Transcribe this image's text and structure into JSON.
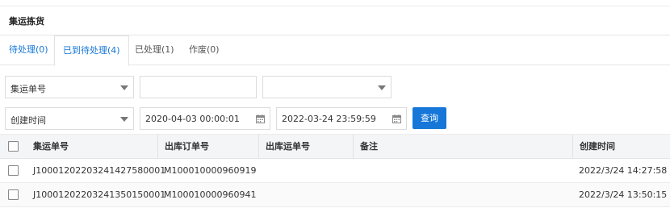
{
  "page": {
    "title": "集运拣货"
  },
  "tabs": [
    {
      "label": "待处理(0)"
    },
    {
      "label": "已到待处理(4)"
    },
    {
      "label": "已处理(1)"
    },
    {
      "label": "作废(0)"
    }
  ],
  "filters": {
    "search_field_select": "集运单号",
    "search_text": "",
    "extra_select": "",
    "date_field_select": "创建时间",
    "date_start": "2020-04-03 00:00:01",
    "date_end": "2022-03-24 23:59:59",
    "query_button": "查询"
  },
  "table": {
    "columns": [
      "集运单号",
      "出库订单号",
      "出库运单号",
      "备注",
      "创建时间"
    ],
    "rows": [
      {
        "consolidation_no": "J10001202203241427580001",
        "order_no": "M100010000960919",
        "waybill_no": "",
        "remark": "",
        "created": "2022/3/24 14:27:58"
      },
      {
        "consolidation_no": "J10001202203241350150001",
        "order_no": "M100010000960941",
        "waybill_no": "",
        "remark": "",
        "created": "2022/3/24 13:50:15"
      }
    ]
  },
  "colors": {
    "accent": "#1677d9",
    "header_bg": "#f4f5f7"
  }
}
